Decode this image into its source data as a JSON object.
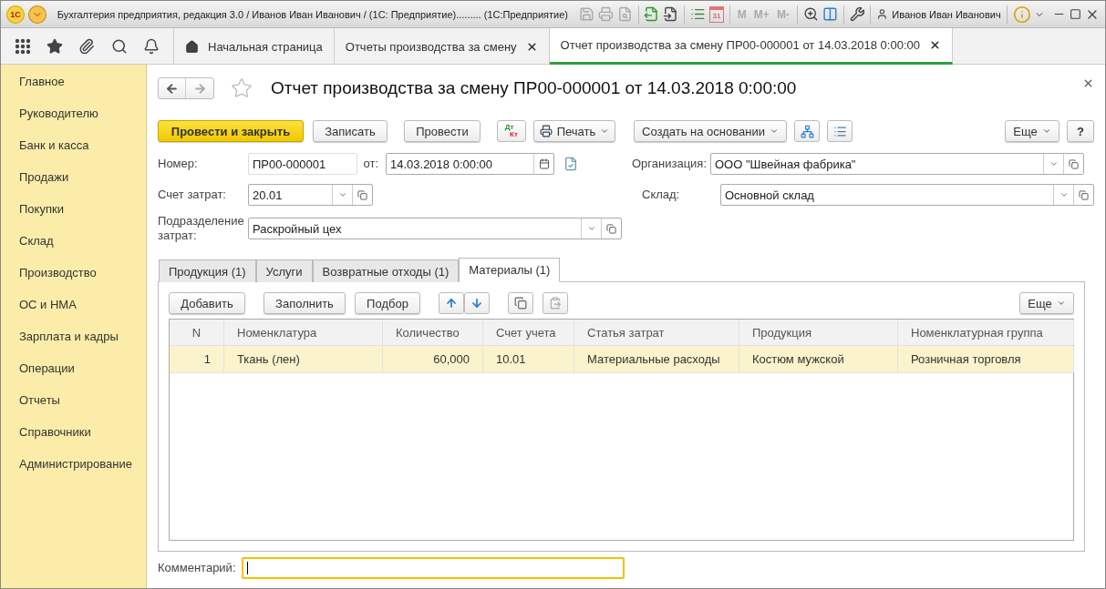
{
  "window": {
    "logo": "1С",
    "title": "Бухгалтерия предприятия, редакция 3.0 / Иванов Иван Иванович / (1С: Предприятие).........  (1С:Предприятие)",
    "calendar_day": "31",
    "memory_buttons": [
      "M",
      "M+",
      "M-"
    ],
    "user": "Иванов Иван Иванович"
  },
  "top_tabs": [
    {
      "kind": "home",
      "label": "Начальная страница",
      "selected": false
    },
    {
      "kind": "doc",
      "label": "Отчеты производства за смену",
      "selected": false
    },
    {
      "kind": "doc",
      "label": "Отчет производства за смену ПР00-000001 от 14.03.2018 0:00:00",
      "selected": true
    }
  ],
  "sidebar": {
    "items": [
      "Главное",
      "Руководителю",
      "Банк и касса",
      "Продажи",
      "Покупки",
      "Склад",
      "Производство",
      "ОС и НМА",
      "Зарплата и кадры",
      "Операции",
      "Отчеты",
      "Справочники",
      "Администрирование"
    ]
  },
  "document": {
    "title": "Отчет производства за смену ПР00-000001 от 14.03.2018 0:00:00",
    "toolbar": {
      "primary": "Провести и закрыть",
      "buttons": [
        "Записать",
        "Провести"
      ],
      "dt": "Дт",
      "kt": "Кт",
      "print": "Печать",
      "create_based": "Создать на основании",
      "more": "Еще",
      "help": "?"
    },
    "number": {
      "label": "Номер:",
      "value": "ПР00-000001"
    },
    "date": {
      "label": "от:",
      "value": "14.03.2018  0:00:00"
    },
    "organization": {
      "label": "Организация:",
      "value": "ООО \"Швейная фабрика\""
    },
    "cost_account": {
      "label": "Счет затрат:",
      "value": "20.01"
    },
    "warehouse": {
      "label": "Склад:",
      "value": "Основной склад"
    },
    "division": {
      "label": "Подразделение затрат:",
      "value": "Раскройный цех"
    },
    "subtabs": [
      {
        "label": "Продукция (1)",
        "selected": false
      },
      {
        "label": "Услуги",
        "selected": false
      },
      {
        "label": "Возвратные отходы (1)",
        "selected": false
      },
      {
        "label": "Материалы (1)",
        "selected": true
      }
    ],
    "table_toolbar": {
      "add": "Добавить",
      "fill": "Заполнить",
      "pick": "Подбор",
      "more": "Еще"
    },
    "table": {
      "columns": [
        "N",
        "Номенклатура",
        "Количество",
        "Счет учета",
        "Статья затрат",
        "Продукция",
        "Номенклатурная группа"
      ],
      "rows": [
        {
          "cells": [
            "1",
            "Ткань (лен)",
            "60,000",
            "10.01",
            "Материальные расходы",
            "Костюм мужской",
            "Розничная торговля"
          ],
          "selected": true
        }
      ]
    },
    "comment": {
      "label": "Комментарий:",
      "focused": true
    }
  }
}
